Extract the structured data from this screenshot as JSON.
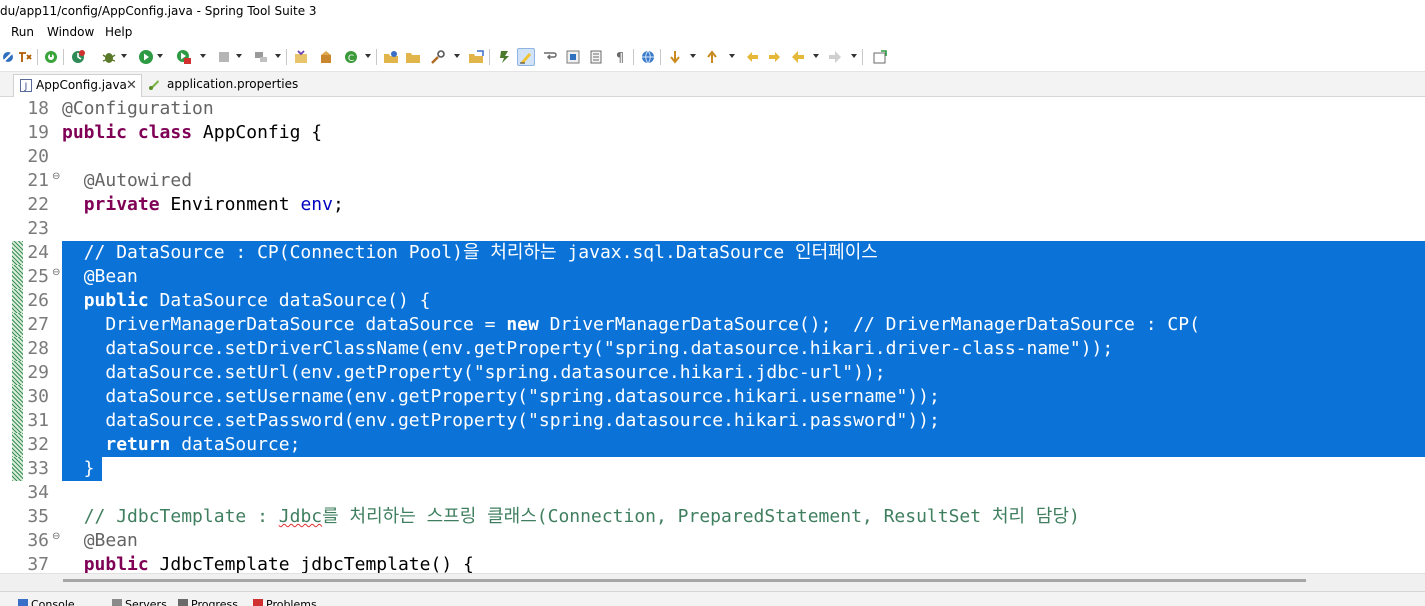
{
  "window": {
    "title": "du/app11/config/AppConfig.java - Spring Tool Suite 3"
  },
  "menu": {
    "items": [
      "Run",
      "Window",
      "Help"
    ]
  },
  "toolbar": {
    "icons": [
      "skip-breakpoints-icon",
      "toggle-ant-icon",
      "stop-icon",
      "debug-icon",
      "debug-dropdown-icon",
      "bug-icon",
      "run-icon",
      "run-dropdown-icon",
      "coverage-icon",
      "server-stop-icon",
      "external-tools-icon",
      "new-java-project-icon",
      "new-package-icon",
      "new-class-icon",
      "open-type-icon",
      "open-folder-icon",
      "search-icon",
      "open-task-icon",
      "toggle-mark-occurrences-icon",
      "highlight-icon",
      "word-wrap-icon",
      "block-selection-icon",
      "show-whitespace-icon",
      "globe-icon",
      "next-annotation-icon",
      "previous-annotation-icon",
      "last-edit-icon",
      "back-icon",
      "forward-icon",
      "pin-editor-icon"
    ]
  },
  "tabs": [
    {
      "label": "AppConfig.java",
      "icon": "java-file-icon",
      "active": true
    },
    {
      "label": "application.properties",
      "icon": "properties-file-icon",
      "active": false
    }
  ],
  "editor": {
    "selection_color": "#0b72d7",
    "lines": [
      {
        "num": "18",
        "text": "@Configuration"
      },
      {
        "num": "19",
        "text": "public class AppConfig {"
      },
      {
        "num": "20",
        "text": ""
      },
      {
        "num": "21",
        "text": "  @Autowired",
        "fold": true
      },
      {
        "num": "22",
        "text": "  private Environment env;"
      },
      {
        "num": "23",
        "text": ""
      },
      {
        "num": "24",
        "text": "  // DataSource : CP(Connection Pool)을 처리하는 javax.sql.DataSource 인터페이스",
        "selected": true
      },
      {
        "num": "25",
        "text": "  @Bean",
        "selected": true,
        "fold": true
      },
      {
        "num": "26",
        "text": "  public DataSource dataSource() {",
        "selected": true
      },
      {
        "num": "27",
        "text": "    DriverManagerDataSource dataSource = new DriverManagerDataSource();  // DriverManagerDataSource : CP(",
        "selected": true
      },
      {
        "num": "28",
        "text": "    dataSource.setDriverClassName(env.getProperty(\"spring.datasource.hikari.driver-class-name\"));",
        "selected": true
      },
      {
        "num": "29",
        "text": "    dataSource.setUrl(env.getProperty(\"spring.datasource.hikari.jdbc-url\"));",
        "selected": true
      },
      {
        "num": "30",
        "text": "    dataSource.setUsername(env.getProperty(\"spring.datasource.hikari.username\"));",
        "selected": true
      },
      {
        "num": "31",
        "text": "    dataSource.setPassword(env.getProperty(\"spring.datasource.hikari.password\"));",
        "selected": true
      },
      {
        "num": "32",
        "text": "    return dataSource;",
        "selected": true
      },
      {
        "num": "33",
        "text": "  }",
        "selected": true
      },
      {
        "num": "34",
        "text": ""
      },
      {
        "num": "35",
        "text": "  // JdbcTemplate : Jdbc를 처리하는 스프링 클래스(Connection, PreparedStatement, ResultSet 처리 담당)"
      },
      {
        "num": "36",
        "text": "  @Bean",
        "fold": true
      },
      {
        "num": "37",
        "text": "  public JdbcTemplate jdbcTemplate() {"
      }
    ]
  },
  "bottom_panel": {
    "tabs": [
      "Console",
      "Servers",
      "Progress",
      "Problems"
    ]
  }
}
